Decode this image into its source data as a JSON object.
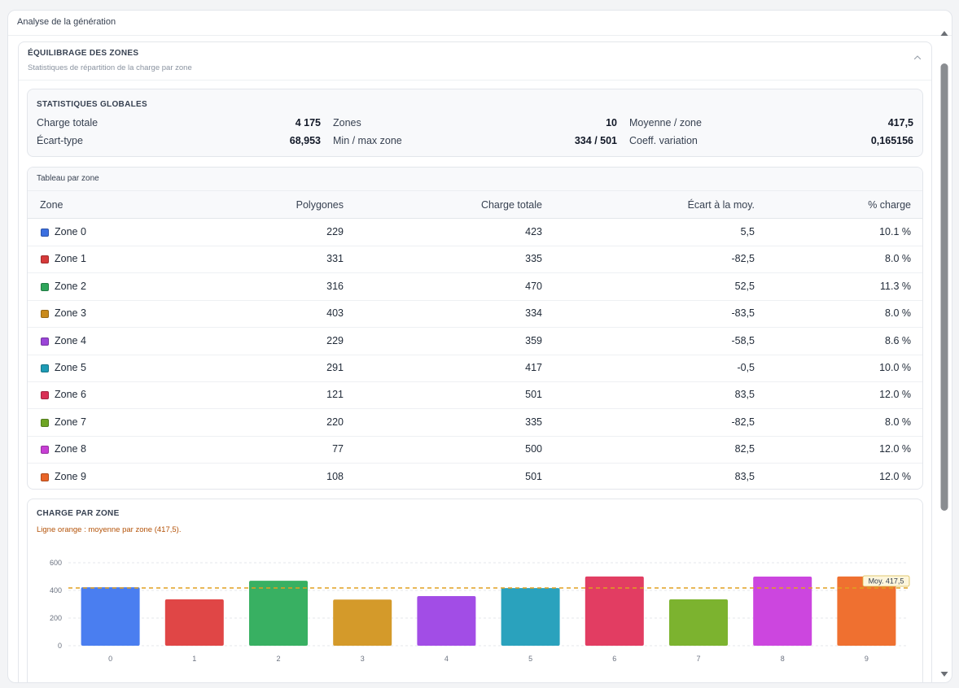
{
  "panel": {
    "title": "Analyse de la génération"
  },
  "section": {
    "title": "ÉQUILIBRAGE DES ZONES",
    "subtitle": "Statistiques de répartition de la charge par zone",
    "collapse_icon": "chevron-up-icon"
  },
  "stats": {
    "title": "STATISTIQUES GLOBALES",
    "items": [
      {
        "label": "Charge totale",
        "value": "4 175"
      },
      {
        "label": "Zones",
        "value": "10"
      },
      {
        "label": "Moyenne / zone",
        "value": "417,5"
      },
      {
        "label": "Écart-type",
        "value": "68,953"
      },
      {
        "label": "Min / max zone",
        "value": "334 / 501"
      },
      {
        "label": "Coeff. variation",
        "value": "0,165156"
      }
    ]
  },
  "table": {
    "title": "Tableau par zone",
    "headers": [
      "Zone",
      "Polygones",
      "Charge totale",
      "Écart à la moy.",
      "% charge"
    ],
    "rows": [
      {
        "zone": "Zone 0",
        "color": "#3b6fe0",
        "polygones": "229",
        "charge": "423",
        "ecart": "5,5",
        "pct": "10.1 %"
      },
      {
        "zone": "Zone 1",
        "color": "#d63a3a",
        "polygones": "331",
        "charge": "335",
        "ecart": "-82,5",
        "pct": "8.0 %"
      },
      {
        "zone": "Zone 2",
        "color": "#2ea55a",
        "polygones": "316",
        "charge": "470",
        "ecart": "52,5",
        "pct": "11.3 %"
      },
      {
        "zone": "Zone 3",
        "color": "#c98a1b",
        "polygones": "403",
        "charge": "334",
        "ecart": "-83,5",
        "pct": "8.0 %"
      },
      {
        "zone": "Zone 4",
        "color": "#9b45d8",
        "polygones": "229",
        "charge": "359",
        "ecart": "-58,5",
        "pct": "8.6 %"
      },
      {
        "zone": "Zone 5",
        "color": "#1e9bb5",
        "polygones": "291",
        "charge": "417",
        "ecart": "-0,5",
        "pct": "10.0 %"
      },
      {
        "zone": "Zone 6",
        "color": "#d92f55",
        "polygones": "121",
        "charge": "501",
        "ecart": "83,5",
        "pct": "12.0 %"
      },
      {
        "zone": "Zone 7",
        "color": "#6ea524",
        "polygones": "220",
        "charge": "335",
        "ecart": "-82,5",
        "pct": "8.0 %"
      },
      {
        "zone": "Zone 8",
        "color": "#c73fd4",
        "polygones": "77",
        "charge": "500",
        "ecart": "82,5",
        "pct": "12.0 %"
      },
      {
        "zone": "Zone 9",
        "color": "#e86427",
        "polygones": "108",
        "charge": "501",
        "ecart": "83,5",
        "pct": "12.0 %"
      }
    ]
  },
  "chart": {
    "title": "CHARGE PAR ZONE",
    "subtitle": "Ligne orange : moyenne par zone (417,5).",
    "mean_label": "Moy. 417,5"
  },
  "chart_data": {
    "type": "bar",
    "categories": [
      "0",
      "1",
      "2",
      "3",
      "4",
      "5",
      "6",
      "7",
      "8",
      "9"
    ],
    "values": [
      423,
      335,
      470,
      334,
      359,
      417,
      501,
      335,
      500,
      501
    ],
    "colors": [
      "#4a7ef0",
      "#e04646",
      "#38b062",
      "#d49a2a",
      "#a24de6",
      "#2aa2bd",
      "#e23d62",
      "#7cb32f",
      "#cc46df",
      "#ef7030"
    ],
    "mean": 417.5,
    "mean_color": "#e0a020",
    "yticks": [
      "600",
      "400",
      "200",
      "0"
    ],
    "ylim": [
      0,
      600
    ],
    "grid": true
  }
}
